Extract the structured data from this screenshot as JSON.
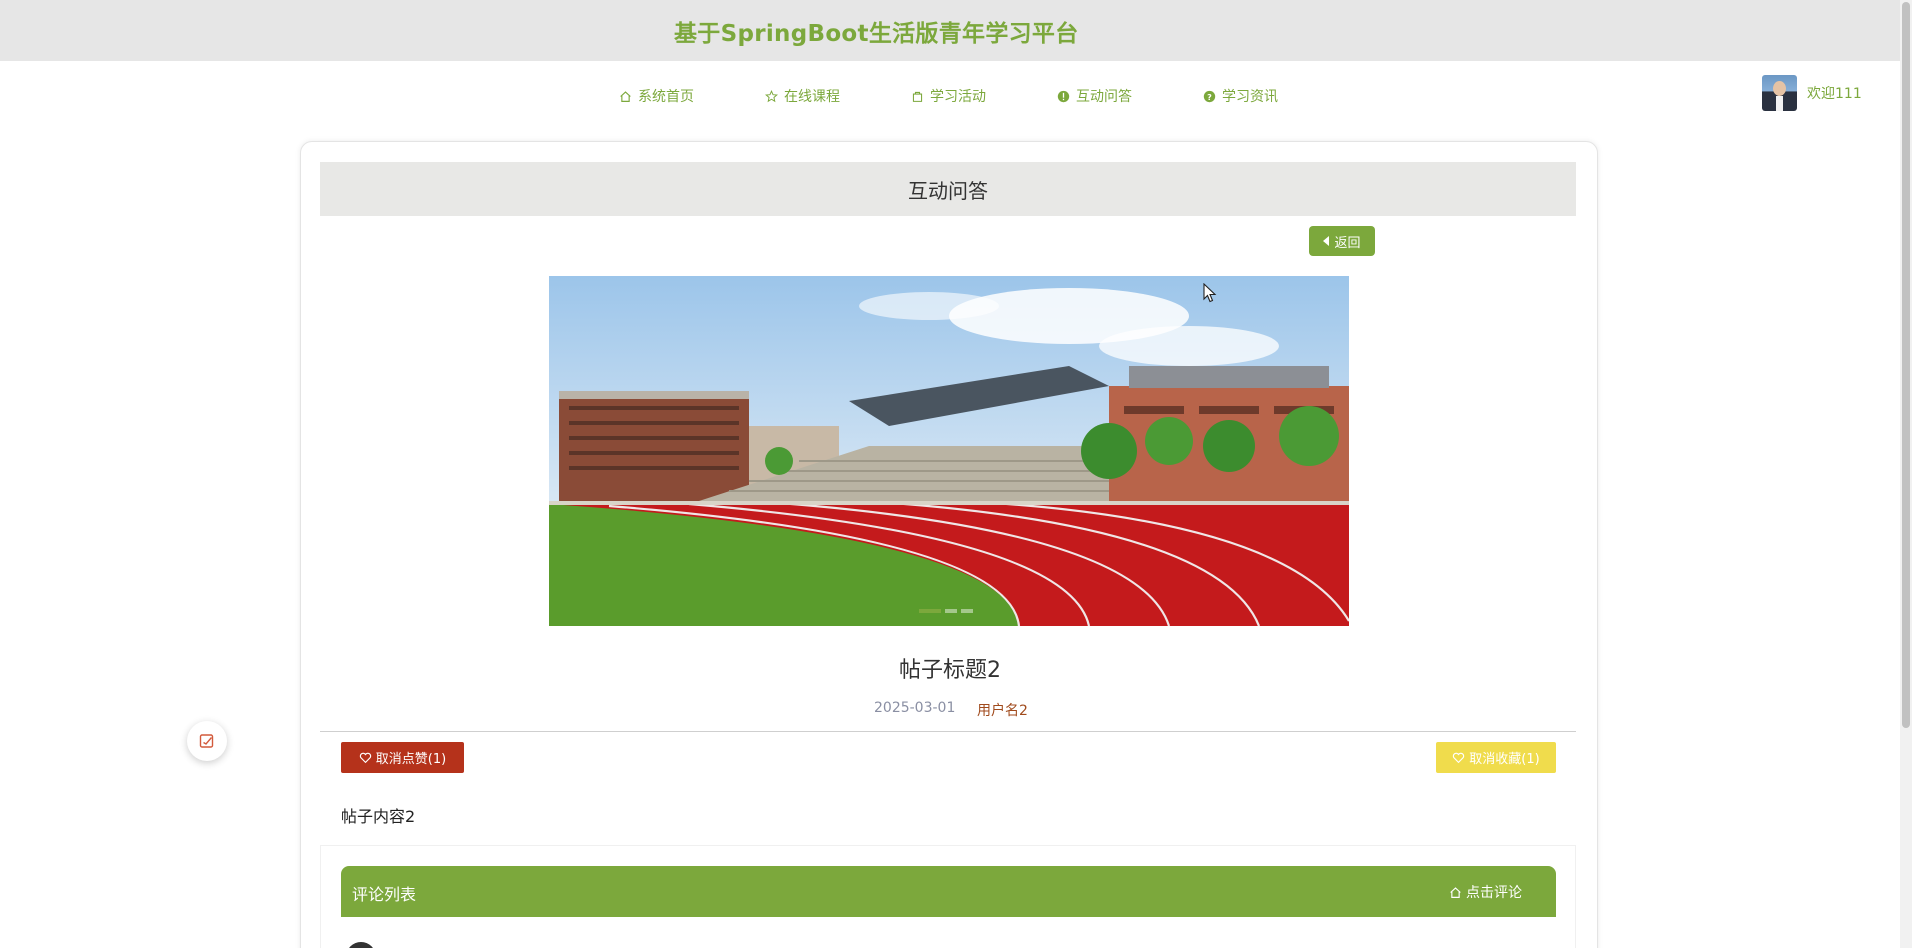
{
  "header": {
    "site_title": "基于SpringBoot生活版青年学习平台"
  },
  "nav": {
    "items": [
      {
        "label": "系统首页",
        "icon": "home-icon"
      },
      {
        "label": "在线课程",
        "icon": "star-icon"
      },
      {
        "label": "学习活动",
        "icon": "bag-icon"
      },
      {
        "label": "互动问答",
        "icon": "info-circle-icon"
      },
      {
        "label": "学习资讯",
        "icon": "question-circle-icon"
      }
    ]
  },
  "user": {
    "welcome": "欢迎111"
  },
  "page": {
    "section_title": "互动问答",
    "back_label": "返回",
    "post_title": "帖子标题2",
    "date": "2025-03-01",
    "author": "用户名2",
    "like_label": "取消点赞(1)",
    "fav_label": "取消收藏(1)",
    "content": "帖子内容2",
    "comment_title": "评论列表",
    "comment_action": "点击评论"
  },
  "colors": {
    "accent": "#7ca83c",
    "like_button": "#b5321b",
    "fav_button": "#f0dc4c",
    "date_text": "#8a8fa3",
    "author_text": "#a04a1c"
  }
}
